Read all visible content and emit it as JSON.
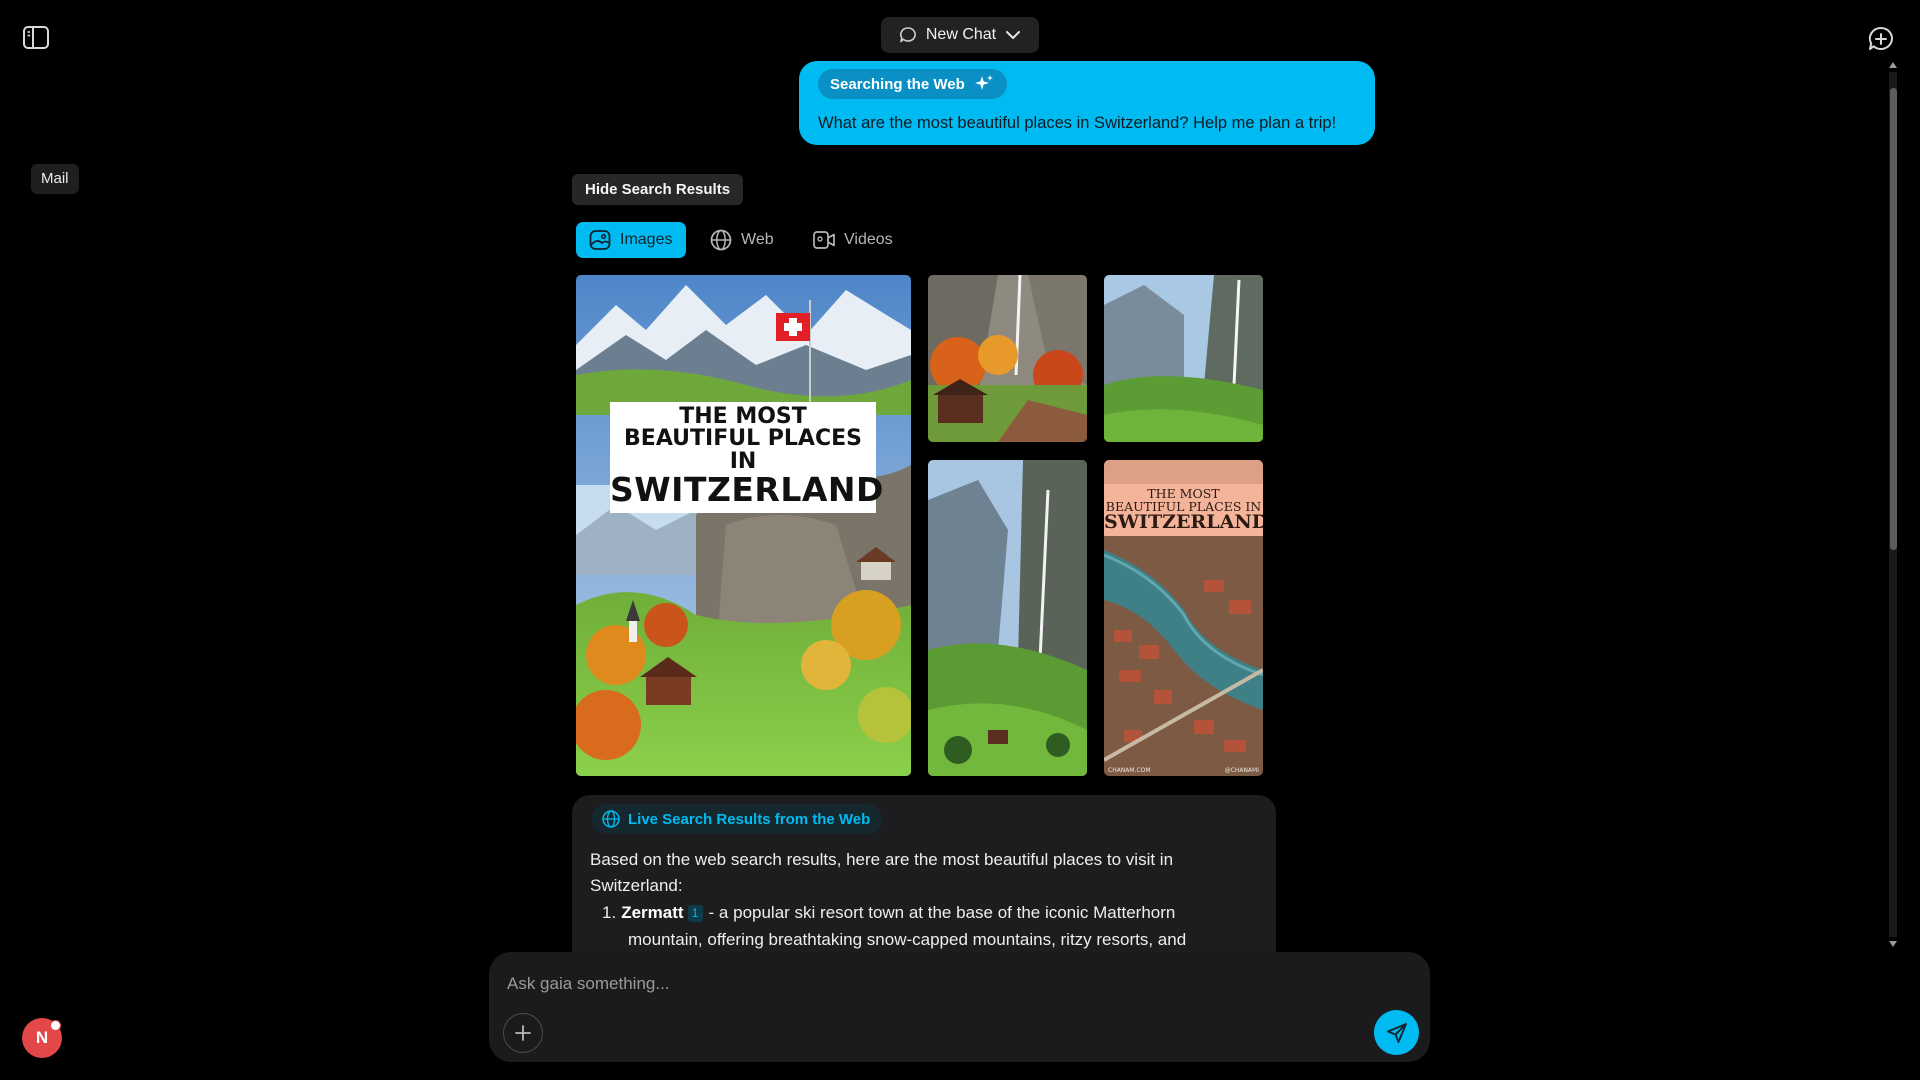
{
  "header": {
    "chat_selector_label": "New Chat"
  },
  "sidebar": {
    "tooltip": "Mail"
  },
  "conversation": {
    "user_message": {
      "status_label": "Searching the Web",
      "text": "What are the most beautiful places in Switzerland? Help me plan a trip!"
    },
    "search_results": {
      "toggle_label": "Hide Search Results",
      "tabs": [
        {
          "label": "Images",
          "icon": "image-icon",
          "active": true
        },
        {
          "label": "Web",
          "icon": "globe-icon",
          "active": false
        },
        {
          "label": "Videos",
          "icon": "video-icon",
          "active": false
        }
      ],
      "images": {
        "main_overlay": [
          "THE MOST",
          "BEAUTIFUL PLACES IN",
          "SWITZERLAND"
        ],
        "small_overlay": [
          "THE MOST",
          "BEAUTIFUL PLACES IN",
          "SWITZERLAND"
        ],
        "small_credits": [
          "CHANAM.COM",
          "@CHANAMI"
        ]
      }
    },
    "answer": {
      "source_label": "Live Search Results from the Web",
      "intro": "Based on the web search results, here are the most beautiful places to visit in Switzerland:",
      "items": [
        {
          "number": "1.",
          "name": "Zermatt",
          "citation": "1",
          "text_line1": "- a popular ski resort town at the base of the iconic Matterhorn",
          "text_line2": "mountain, offering breathtaking snow-capped mountains, ritzy resorts, and"
        }
      ]
    }
  },
  "composer": {
    "placeholder": "Ask gaia something..."
  },
  "user": {
    "avatar_initial": "N"
  },
  "colors": {
    "accent": "#00bbf1",
    "background": "#000000",
    "avatar": "#e24848"
  }
}
